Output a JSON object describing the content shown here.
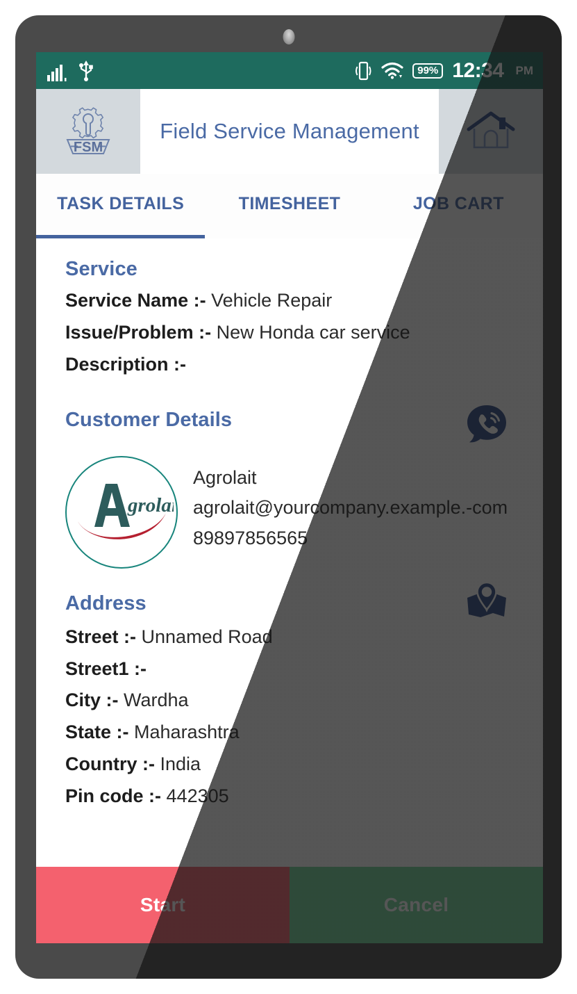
{
  "status_bar": {
    "signal_icon": "cellular-signal-icon",
    "usb_icon": "usb-icon",
    "vibrate_icon": "vibrate-icon",
    "wifi_icon": "wifi-icon",
    "battery_percent": "99%",
    "time": "12:34",
    "ampm": "PM"
  },
  "header": {
    "logo_icon": "fsm-logo-icon",
    "logo_text": "FSM",
    "title": "Field Service Management",
    "home_icon": "home-icon"
  },
  "tabs": [
    {
      "label": "TASK DETAILS",
      "active": true
    },
    {
      "label": "TIMESHEET",
      "active": false
    },
    {
      "label": "JOB CART",
      "active": false
    }
  ],
  "service": {
    "heading": "Service",
    "rows": [
      {
        "key": "Service Name :-",
        "value": "Vehicle Repair"
      },
      {
        "key": "Issue/Problem :-",
        "value": "New Honda car service"
      },
      {
        "key": "Description :-",
        "value": ""
      }
    ]
  },
  "customer": {
    "heading": "Customer Details",
    "call_icon": "phone-call-bubble-icon",
    "avatar_icon": "agrolait-logo-icon",
    "avatar_text": "grolait",
    "name": "Agrolait",
    "email": "agrolait@yourcompany.example.-com",
    "phone": "89897856565"
  },
  "address": {
    "heading": "Address",
    "map_icon": "map-location-pin-icon",
    "rows": [
      {
        "key": "Street :-",
        "value": "Unnamed Road"
      },
      {
        "key": "Street1 :-",
        "value": ""
      },
      {
        "key": "City :-",
        "value": "Wardha"
      },
      {
        "key": "State :-",
        "value": "Maharashtra"
      },
      {
        "key": "Country :-",
        "value": "India"
      },
      {
        "key": "Pin code :-",
        "value": "442305"
      }
    ]
  },
  "actions": {
    "start_label": "Start",
    "cancel_label": "Cancel"
  },
  "colors": {
    "status_bar": "#1e6b5e",
    "accent_blue": "#4a6aa5",
    "tab_active": "#44639e",
    "start_red": "#f4616e",
    "cancel_green": "#71d69a",
    "header_side": "#d3d9dd",
    "avatar_border": "#18857c",
    "bezel": "#4a4a4a"
  }
}
